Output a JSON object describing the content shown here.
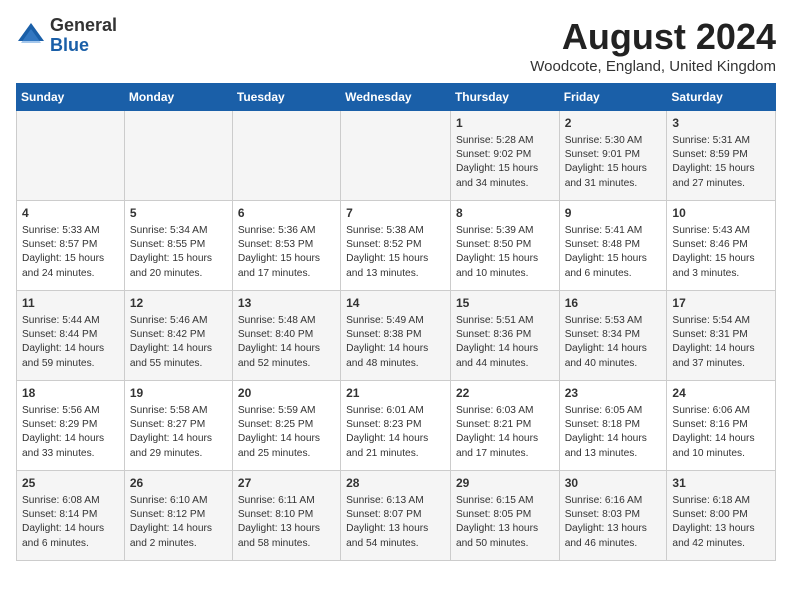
{
  "logo": {
    "general": "General",
    "blue": "Blue"
  },
  "title": "August 2024",
  "location": "Woodcote, England, United Kingdom",
  "days_header": [
    "Sunday",
    "Monday",
    "Tuesday",
    "Wednesday",
    "Thursday",
    "Friday",
    "Saturday"
  ],
  "weeks": [
    [
      {
        "day": "",
        "info": ""
      },
      {
        "day": "",
        "info": ""
      },
      {
        "day": "",
        "info": ""
      },
      {
        "day": "",
        "info": ""
      },
      {
        "day": "1",
        "info": "Sunrise: 5:28 AM\nSunset: 9:02 PM\nDaylight: 15 hours\nand 34 minutes."
      },
      {
        "day": "2",
        "info": "Sunrise: 5:30 AM\nSunset: 9:01 PM\nDaylight: 15 hours\nand 31 minutes."
      },
      {
        "day": "3",
        "info": "Sunrise: 5:31 AM\nSunset: 8:59 PM\nDaylight: 15 hours\nand 27 minutes."
      }
    ],
    [
      {
        "day": "4",
        "info": "Sunrise: 5:33 AM\nSunset: 8:57 PM\nDaylight: 15 hours\nand 24 minutes."
      },
      {
        "day": "5",
        "info": "Sunrise: 5:34 AM\nSunset: 8:55 PM\nDaylight: 15 hours\nand 20 minutes."
      },
      {
        "day": "6",
        "info": "Sunrise: 5:36 AM\nSunset: 8:53 PM\nDaylight: 15 hours\nand 17 minutes."
      },
      {
        "day": "7",
        "info": "Sunrise: 5:38 AM\nSunset: 8:52 PM\nDaylight: 15 hours\nand 13 minutes."
      },
      {
        "day": "8",
        "info": "Sunrise: 5:39 AM\nSunset: 8:50 PM\nDaylight: 15 hours\nand 10 minutes."
      },
      {
        "day": "9",
        "info": "Sunrise: 5:41 AM\nSunset: 8:48 PM\nDaylight: 15 hours\nand 6 minutes."
      },
      {
        "day": "10",
        "info": "Sunrise: 5:43 AM\nSunset: 8:46 PM\nDaylight: 15 hours\nand 3 minutes."
      }
    ],
    [
      {
        "day": "11",
        "info": "Sunrise: 5:44 AM\nSunset: 8:44 PM\nDaylight: 14 hours\nand 59 minutes."
      },
      {
        "day": "12",
        "info": "Sunrise: 5:46 AM\nSunset: 8:42 PM\nDaylight: 14 hours\nand 55 minutes."
      },
      {
        "day": "13",
        "info": "Sunrise: 5:48 AM\nSunset: 8:40 PM\nDaylight: 14 hours\nand 52 minutes."
      },
      {
        "day": "14",
        "info": "Sunrise: 5:49 AM\nSunset: 8:38 PM\nDaylight: 14 hours\nand 48 minutes."
      },
      {
        "day": "15",
        "info": "Sunrise: 5:51 AM\nSunset: 8:36 PM\nDaylight: 14 hours\nand 44 minutes."
      },
      {
        "day": "16",
        "info": "Sunrise: 5:53 AM\nSunset: 8:34 PM\nDaylight: 14 hours\nand 40 minutes."
      },
      {
        "day": "17",
        "info": "Sunrise: 5:54 AM\nSunset: 8:31 PM\nDaylight: 14 hours\nand 37 minutes."
      }
    ],
    [
      {
        "day": "18",
        "info": "Sunrise: 5:56 AM\nSunset: 8:29 PM\nDaylight: 14 hours\nand 33 minutes."
      },
      {
        "day": "19",
        "info": "Sunrise: 5:58 AM\nSunset: 8:27 PM\nDaylight: 14 hours\nand 29 minutes."
      },
      {
        "day": "20",
        "info": "Sunrise: 5:59 AM\nSunset: 8:25 PM\nDaylight: 14 hours\nand 25 minutes."
      },
      {
        "day": "21",
        "info": "Sunrise: 6:01 AM\nSunset: 8:23 PM\nDaylight: 14 hours\nand 21 minutes."
      },
      {
        "day": "22",
        "info": "Sunrise: 6:03 AM\nSunset: 8:21 PM\nDaylight: 14 hours\nand 17 minutes."
      },
      {
        "day": "23",
        "info": "Sunrise: 6:05 AM\nSunset: 8:18 PM\nDaylight: 14 hours\nand 13 minutes."
      },
      {
        "day": "24",
        "info": "Sunrise: 6:06 AM\nSunset: 8:16 PM\nDaylight: 14 hours\nand 10 minutes."
      }
    ],
    [
      {
        "day": "25",
        "info": "Sunrise: 6:08 AM\nSunset: 8:14 PM\nDaylight: 14 hours\nand 6 minutes."
      },
      {
        "day": "26",
        "info": "Sunrise: 6:10 AM\nSunset: 8:12 PM\nDaylight: 14 hours\nand 2 minutes."
      },
      {
        "day": "27",
        "info": "Sunrise: 6:11 AM\nSunset: 8:10 PM\nDaylight: 13 hours\nand 58 minutes."
      },
      {
        "day": "28",
        "info": "Sunrise: 6:13 AM\nSunset: 8:07 PM\nDaylight: 13 hours\nand 54 minutes."
      },
      {
        "day": "29",
        "info": "Sunrise: 6:15 AM\nSunset: 8:05 PM\nDaylight: 13 hours\nand 50 minutes."
      },
      {
        "day": "30",
        "info": "Sunrise: 6:16 AM\nSunset: 8:03 PM\nDaylight: 13 hours\nand 46 minutes."
      },
      {
        "day": "31",
        "info": "Sunrise: 6:18 AM\nSunset: 8:00 PM\nDaylight: 13 hours\nand 42 minutes."
      }
    ]
  ]
}
